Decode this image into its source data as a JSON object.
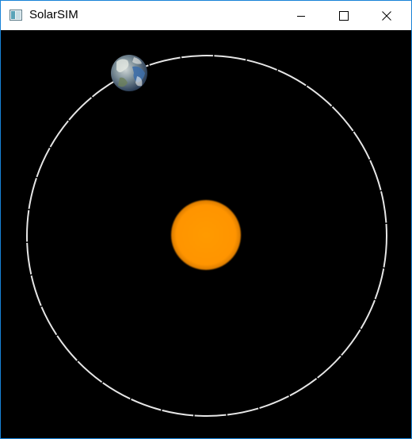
{
  "window": {
    "title": "SolarSIM",
    "controls": [
      "minimize",
      "maximize",
      "close"
    ]
  },
  "scene": {
    "background_color": "#000000",
    "orbit_color": "#e6e6e6",
    "sun": {
      "name": "sun",
      "color": "#ff9400"
    },
    "planet": {
      "name": "earth",
      "colors": [
        "#3d6ea8",
        "#dfe3e0"
      ]
    }
  },
  "accent_color": "#1883d7"
}
